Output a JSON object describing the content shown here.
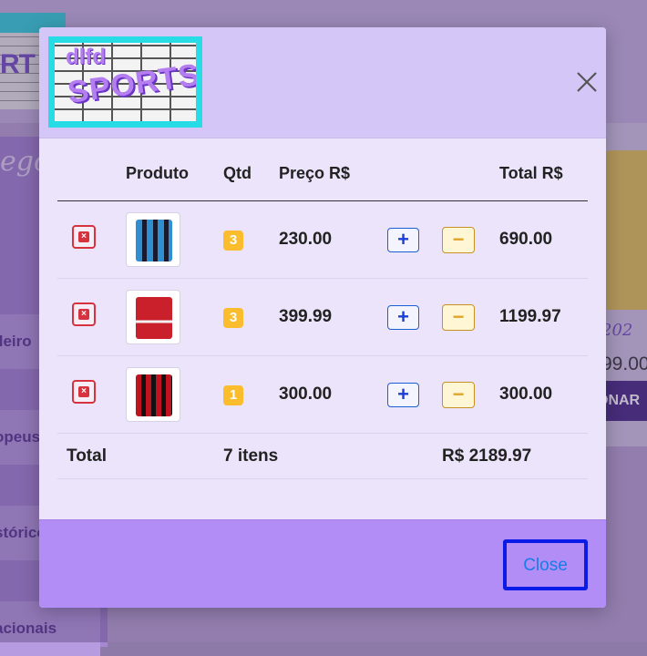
{
  "background": {
    "sidebar_title": "egori",
    "sidebar_items": [
      "ileiro",
      "opeus",
      "stórico",
      "acionais"
    ],
    "logo_fragment": "RT",
    "product_name": "202",
    "product_price": "99.00",
    "product_button": "ONAR"
  },
  "modal": {
    "logo_small": "dlfd",
    "logo_text": "SPORTS",
    "columns": [
      "",
      "Produto",
      "Qtd",
      "Preço R$",
      "",
      "",
      "Total R$"
    ],
    "items": [
      {
        "qty": "3",
        "price": "230.00",
        "total": "690.00",
        "jersey_colors": [
          "#2f8fd0",
          "#1a1a2e"
        ]
      },
      {
        "qty": "3",
        "price": "399.99",
        "total": "1199.97",
        "jersey_colors": [
          "#c9202c",
          "#f2f2f2"
        ]
      },
      {
        "qty": "1",
        "price": "300.00",
        "total": "300.00",
        "jersey_colors": [
          "#c1121f",
          "#111111"
        ]
      }
    ],
    "total_label": "Total",
    "total_items": "7 itens",
    "total_value": "R$ 2189.97",
    "plus_symbol": "+",
    "minus_symbol": "−",
    "delete_symbol": "×",
    "close_label": "Close"
  }
}
